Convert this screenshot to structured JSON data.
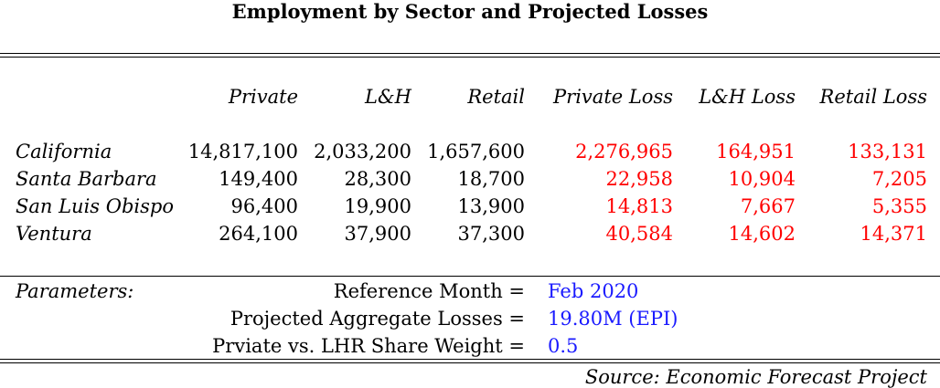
{
  "title": "Employment by Sector and Projected Losses",
  "columns": [
    "Private",
    "L&H",
    "Retail",
    "Private Loss",
    "L&H Loss",
    "Retail Loss"
  ],
  "rows": [
    {
      "name": "California",
      "values": [
        "14,817,100",
        "2,033,200",
        "1,657,600",
        "2,276,965",
        "164,951",
        "133,131"
      ]
    },
    {
      "name": "Santa Barbara",
      "values": [
        "149,400",
        "28,300",
        "18,700",
        "22,958",
        "10,904",
        "7,205"
      ]
    },
    {
      "name": "San Luis Obispo",
      "values": [
        "96,400",
        "19,900",
        "13,900",
        "14,813",
        "7,667",
        "5,355"
      ]
    },
    {
      "name": "Ventura",
      "values": [
        "264,100",
        "37,900",
        "37,300",
        "40,584",
        "14,602",
        "14,371"
      ]
    }
  ],
  "parameters": {
    "label": "Parameters:",
    "items": [
      {
        "key": "Reference Month =",
        "value": "Feb 2020"
      },
      {
        "key": "Projected Aggregate Losses =",
        "value": "19.80M (EPI)"
      },
      {
        "key": "Prviate vs. LHR Share Weight =",
        "value": "0.5"
      }
    ]
  },
  "source": "Source: Economic Forecast Project",
  "colors": {
    "loss": "#ff0000",
    "parameter_value": "#1a1aff"
  }
}
